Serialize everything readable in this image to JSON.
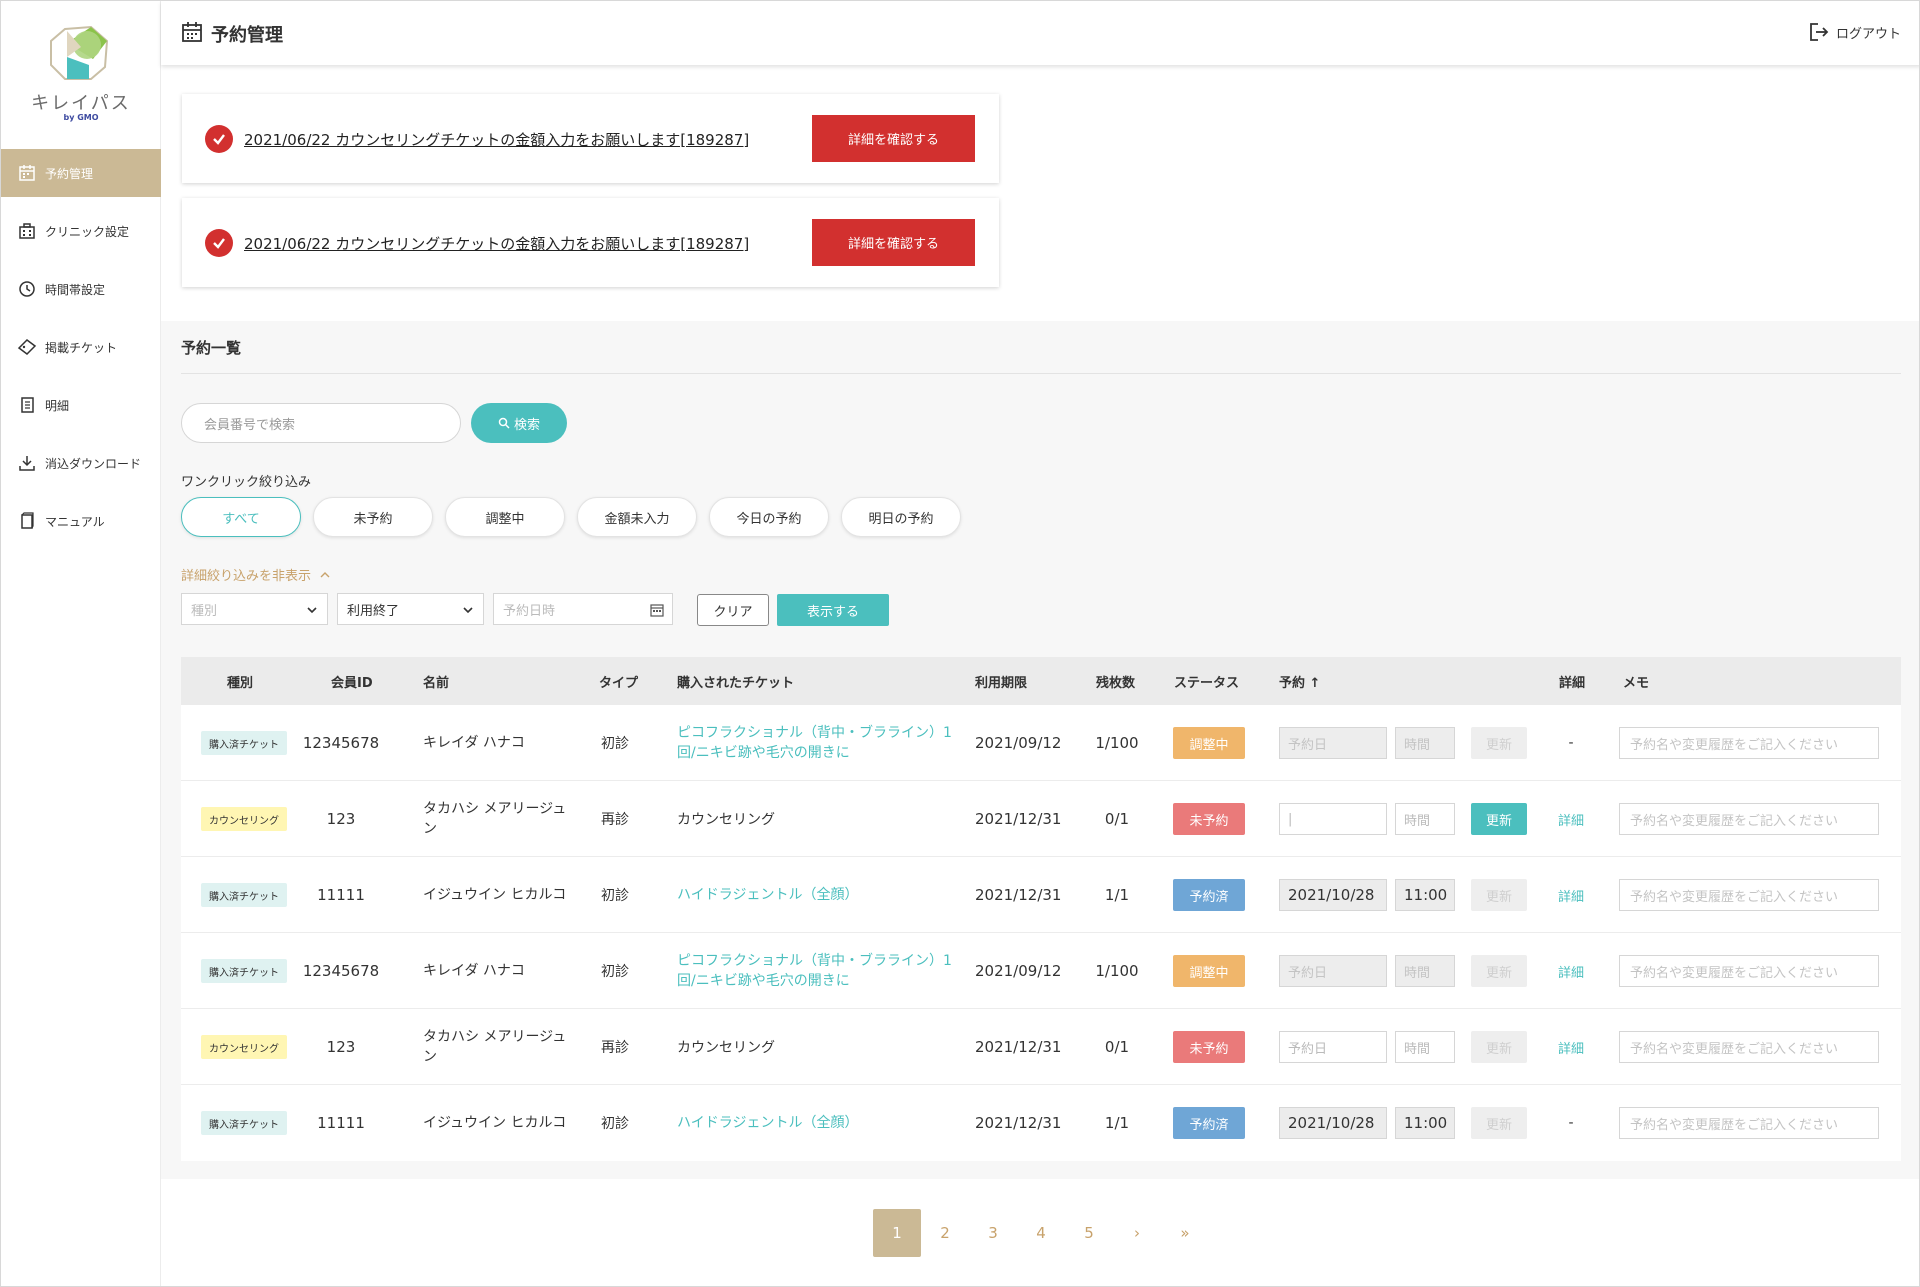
{
  "brand": {
    "logo_text": "キレイパス",
    "logo_sub": "by GMO",
    "colors": {
      "accent": "#cbb995",
      "teal": "#4bbfbe",
      "red": "#d2302f",
      "gold_text": "#c8a26b"
    }
  },
  "sidebar": {
    "items": [
      {
        "label": "予約管理",
        "icon": "calendar-icon",
        "active": true
      },
      {
        "label": "クリニック設定",
        "icon": "building-icon",
        "active": false
      },
      {
        "label": "時間帯設定",
        "icon": "clock-icon",
        "active": false
      },
      {
        "label": "掲載チケット",
        "icon": "ticket-icon",
        "active": false
      },
      {
        "label": "明細",
        "icon": "document-icon",
        "active": false
      },
      {
        "label": "消込ダウンロード",
        "icon": "download-icon",
        "active": false
      },
      {
        "label": "マニュアル",
        "icon": "book-icon",
        "active": false
      }
    ]
  },
  "header": {
    "title": "予約管理",
    "logout_label": "ログアウト"
  },
  "notifications": [
    {
      "text": "2021/06/22 カウンセリングチケットの金額入力をお願いします[189287]",
      "button": "詳細を確認する"
    },
    {
      "text": "2021/06/22 カウンセリングチケットの金額入力をお願いします[189287]",
      "button": "詳細を確認する"
    }
  ],
  "list": {
    "title": "予約一覧",
    "search_placeholder": "会員番号で検索",
    "search_button": "検索",
    "oneclick_label": "ワンクリック絞り込み",
    "chips": [
      "すべて",
      "未予約",
      "調整中",
      "金額未入力",
      "今日の予約",
      "明日の予約"
    ],
    "active_chip": "すべて",
    "filter_toggle": "詳細絞り込みを非表示",
    "filters": {
      "type_placeholder": "種別",
      "usage_value": "利用終了",
      "datetime_placeholder": "予約日時",
      "clear_button": "クリア",
      "show_button": "表示する"
    }
  },
  "table": {
    "headers": [
      "種別",
      "会員ID",
      "名前",
      "タイプ",
      "購入されたチケット",
      "利用期限",
      "残枚数",
      "ステータス",
      "予約",
      "詳細",
      "メモ"
    ],
    "sort_indicator": "↑",
    "date_placeholder": "予約日",
    "time_placeholder": "時間",
    "update_label": "更新",
    "detail_label": "詳細",
    "memo_placeholder": "予約名や変更履歴をご記入ください",
    "rows": [
      {
        "kind": "購入済チケット",
        "kind_style": "purchased",
        "member_id": "12345678",
        "name": "キレイダ ハナコ",
        "type": "初診",
        "ticket": "ピコフラクショナル（背中・ブラライン）1回/ニキビ跡や毛穴の開きに",
        "ticket_link": true,
        "expiry": "2021/09/12",
        "remaining": "1/100",
        "status": "調整中",
        "status_style": "adj",
        "date": "",
        "time": "",
        "field_state": "disabled",
        "update_enabled": false,
        "detail": "-"
      },
      {
        "kind": "カウンセリング",
        "kind_style": "counsel",
        "member_id": "123",
        "name": "タカハシ メアリージュン",
        "type": "再診",
        "ticket": "カウンセリング",
        "ticket_link": false,
        "expiry": "2021/12/31",
        "remaining": "0/1",
        "status": "未予約",
        "status_style": "not",
        "date": "|",
        "time": "",
        "field_state": "editable",
        "update_enabled": true,
        "detail": "詳細"
      },
      {
        "kind": "購入済チケット",
        "kind_style": "purchased",
        "member_id": "11111",
        "name": "イジュウイン ヒカルコ",
        "type": "初診",
        "ticket": "ハイドラジェントル（全顔）",
        "ticket_link": true,
        "expiry": "2021/12/31",
        "remaining": "1/1",
        "status": "予約済",
        "status_style": "done",
        "date": "2021/10/28",
        "time": "11:00",
        "field_state": "value",
        "update_enabled": false,
        "detail": "詳細"
      },
      {
        "kind": "購入済チケット",
        "kind_style": "purchased",
        "member_id": "12345678",
        "name": "キレイダ ハナコ",
        "type": "初診",
        "ticket": "ピコフラクショナル（背中・ブラライン）1回/ニキビ跡や毛穴の開きに",
        "ticket_link": true,
        "expiry": "2021/09/12",
        "remaining": "1/100",
        "status": "調整中",
        "status_style": "adj",
        "date": "",
        "time": "",
        "field_state": "disabled",
        "update_enabled": false,
        "detail": "詳細"
      },
      {
        "kind": "カウンセリング",
        "kind_style": "counsel",
        "member_id": "123",
        "name": "タカハシ メアリージュン",
        "type": "再診",
        "ticket": "カウンセリング",
        "ticket_link": false,
        "expiry": "2021/12/31",
        "remaining": "0/1",
        "status": "未予約",
        "status_style": "not",
        "date": "",
        "time": "",
        "field_state": "editable",
        "update_enabled": false,
        "detail": "詳細"
      },
      {
        "kind": "購入済チケット",
        "kind_style": "purchased",
        "member_id": "11111",
        "name": "イジュウイン ヒカルコ",
        "type": "初診",
        "ticket": "ハイドラジェントル（全顔）",
        "ticket_link": true,
        "expiry": "2021/12/31",
        "remaining": "1/1",
        "status": "予約済",
        "status_style": "done",
        "date": "2021/10/28",
        "time": "11:00",
        "field_state": "value",
        "update_enabled": false,
        "detail": "-"
      }
    ]
  },
  "pagination": {
    "pages": [
      "1",
      "2",
      "3",
      "4",
      "5"
    ],
    "current": "1",
    "next": "›",
    "last": "»"
  }
}
